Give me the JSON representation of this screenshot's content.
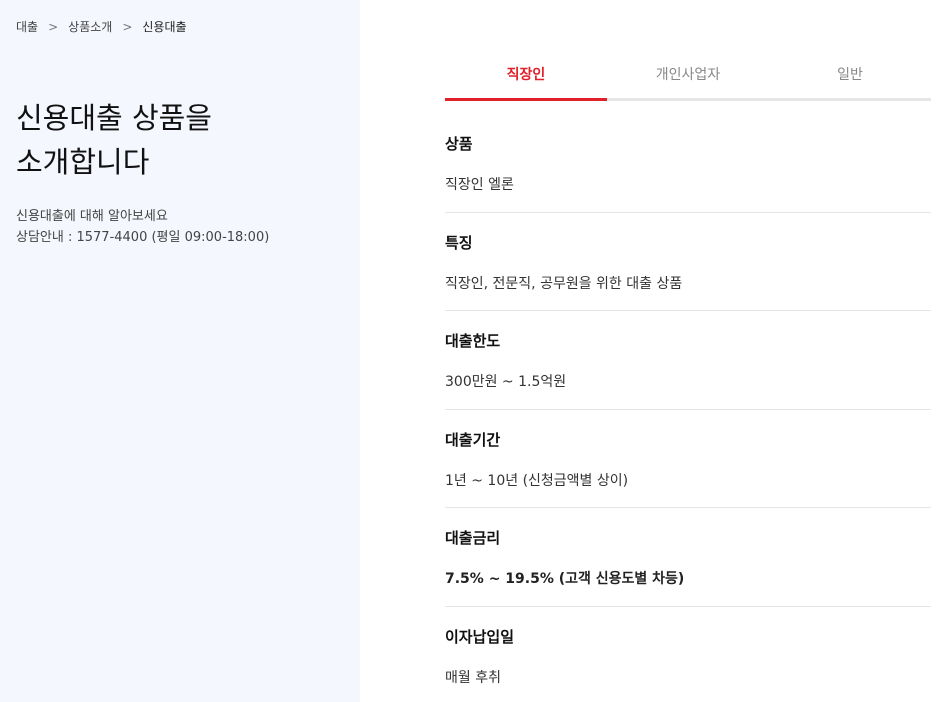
{
  "breadcrumb": [
    "대출",
    "상품소개",
    "신용대출"
  ],
  "hero": {
    "title_line1": "신용대출 상품을",
    "title_line2": "소개합니다",
    "desc_line1": "신용대출에 대해 알아보세요",
    "desc_line2": "상담안내 : 1577-4400 (평일 09:00-18:00)"
  },
  "tabs": [
    "직장인",
    "개인사업자",
    "일반"
  ],
  "active_tab": "직장인",
  "rows": [
    {
      "label": "상품",
      "value": "직장인 엘론"
    },
    {
      "label": "특징",
      "value": "직장인, 전문직, 공무원을 위한 대출 상품"
    },
    {
      "label": "대출한도",
      "value": "300만원 ~ 1.5억원"
    },
    {
      "label": "대출기간",
      "value": "1년 ~ 10년 (신청금액별 상이)"
    },
    {
      "label": "대출금리",
      "value": "7.5% ~ 19.5% (고객 신용도별 차등)"
    },
    {
      "label": "이자납입일",
      "value": "매월 후취"
    }
  ],
  "colors": {
    "accent": "#e0202a",
    "left_bg": "#f4f7fd"
  },
  "icons": {
    "breadcrumb_separator": "chevron-right-icon"
  }
}
